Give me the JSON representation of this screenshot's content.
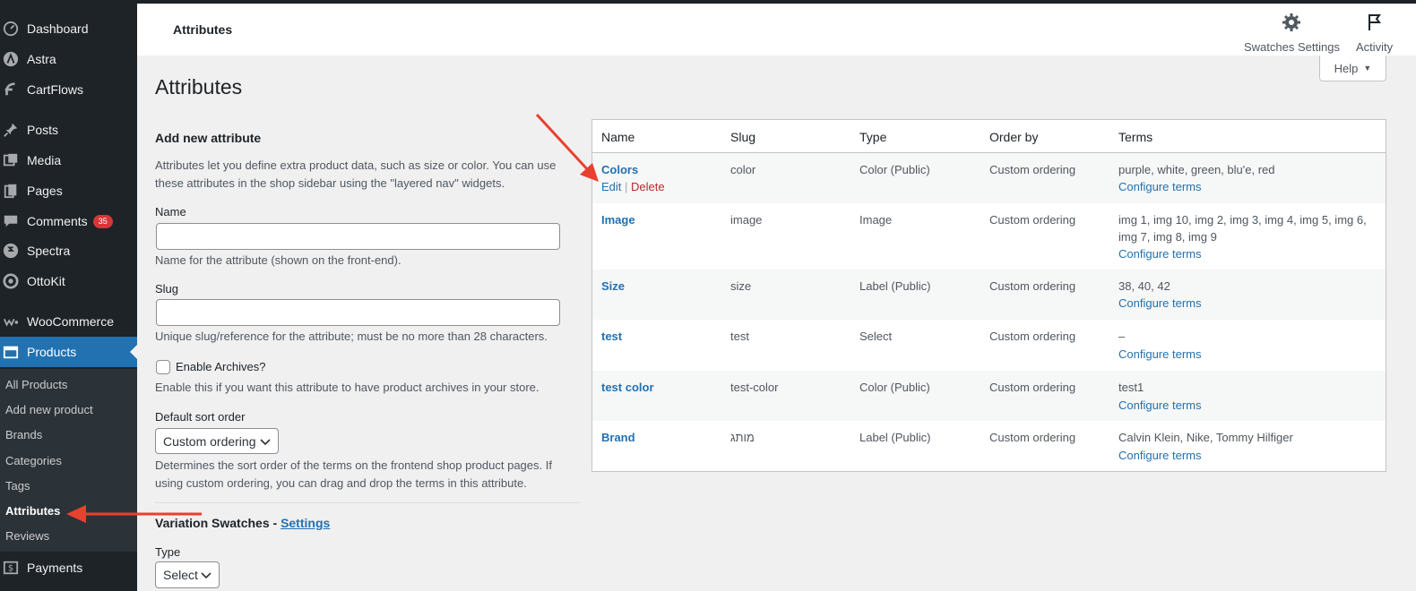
{
  "sidebar": {
    "items": [
      {
        "label": "Dashboard",
        "icon": "dashboard-icon"
      },
      {
        "label": "Astra",
        "icon": "astra-icon"
      },
      {
        "label": "CartFlows",
        "icon": "cartflows-icon"
      },
      {
        "label": "Posts",
        "icon": "pin-icon"
      },
      {
        "label": "Media",
        "icon": "media-icon"
      },
      {
        "label": "Pages",
        "icon": "pages-icon"
      },
      {
        "label": "Comments",
        "icon": "comments-icon",
        "badge": "35"
      },
      {
        "label": "Spectra",
        "icon": "spectra-icon"
      },
      {
        "label": "OttoKit",
        "icon": "ottokit-icon"
      },
      {
        "label": "WooCommerce",
        "icon": "woocommerce-icon"
      },
      {
        "label": "Products",
        "icon": "products-icon"
      },
      {
        "label": "Payments",
        "icon": "payments-icon"
      }
    ],
    "submenu": [
      "All Products",
      "Add new product",
      "Brands",
      "Categories",
      "Tags",
      "Attributes",
      "Reviews"
    ],
    "current_submenu": "Attributes"
  },
  "header": {
    "title": "Attributes",
    "swatches_label": "Swatches Settings",
    "activity_label": "Activity",
    "help_label": "Help"
  },
  "page_title": "Attributes",
  "form": {
    "heading": "Add new attribute",
    "intro": "Attributes let you define extra product data, such as size or color. You can use these attributes in the shop sidebar using the \"layered nav\" widgets.",
    "name_label": "Name",
    "name_value": "",
    "name_desc": "Name for the attribute (shown on the front-end).",
    "slug_label": "Slug",
    "slug_value": "",
    "slug_desc": "Unique slug/reference for the attribute; must be no more than 28 characters.",
    "archives_label": "Enable Archives?",
    "archives_desc": "Enable this if you want this attribute to have product archives in your store.",
    "sort_label": "Default sort order",
    "sort_value": "Custom ordering",
    "sort_desc": "Determines the sort order of the terms on the frontend shop product pages. If using custom ordering, you can drag and drop the terms in this attribute.",
    "swatches_heading": "Variation Swatches - ",
    "swatches_link": "Settings",
    "type_label": "Type",
    "type_value": "Select"
  },
  "table": {
    "headers": [
      "Name",
      "Slug",
      "Type",
      "Order by",
      "Terms"
    ],
    "rows": [
      {
        "name": "Colors",
        "slug": "color",
        "type": "Color (Public)",
        "order": "Custom ordering",
        "terms": "purple, white, green, blu'e, red",
        "configure": "Configure terms",
        "edit": "Edit",
        "sep": "|",
        "delete": "Delete"
      },
      {
        "name": "Image",
        "slug": "image",
        "type": "Image",
        "order": "Custom ordering",
        "terms": "img 1, img 10, img 2, img 3, img 4, img 5, img 6, img 7, img 8, img 9",
        "configure": "Configure terms"
      },
      {
        "name": "Size",
        "slug": "size",
        "type": "Label (Public)",
        "order": "Custom ordering",
        "terms": "38, 40, 42",
        "configure": "Configure terms"
      },
      {
        "name": "test",
        "slug": "test",
        "type": "Select",
        "order": "Custom ordering",
        "terms": "–",
        "configure": "Configure terms"
      },
      {
        "name": "test color",
        "slug": "test-color",
        "type": "Color (Public)",
        "order": "Custom ordering",
        "terms": "test1",
        "configure": "Configure terms"
      },
      {
        "name": "Brand",
        "slug": "מותג",
        "type": "Label (Public)",
        "order": "Custom ordering",
        "terms": "Calvin Klein, Nike, Tommy Hilfiger",
        "configure": "Configure terms"
      }
    ]
  },
  "colors": {
    "sidebar_bg": "#1d2327",
    "accent": "#2271b1",
    "badge": "#d63638",
    "annotation_arrow": "#e8412f"
  }
}
